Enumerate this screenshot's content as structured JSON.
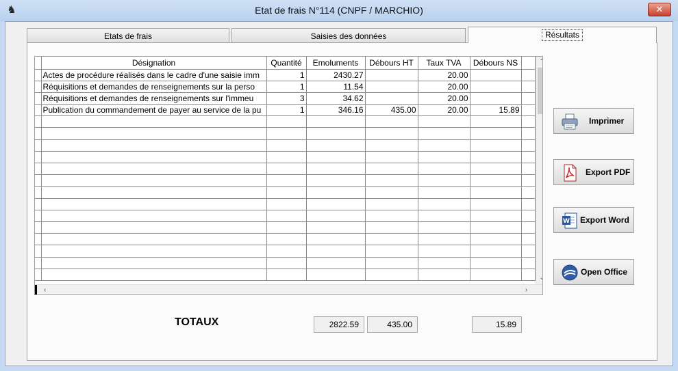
{
  "window": {
    "title": "Etat de frais N°114 (CNPF / MARCHIO)",
    "close_glyph": "✕"
  },
  "tabs": [
    {
      "label": "Etats de frais"
    },
    {
      "label": "Saisies des données"
    },
    {
      "label": "Résultats"
    }
  ],
  "grid": {
    "columns": [
      "Désignation",
      "Quantité",
      "Emoluments",
      "Débours HT",
      "Taux TVA",
      "Débours NS"
    ],
    "rows": [
      [
        "Actes de procédure réalisés dans le cadre d'une saisie imm",
        "1",
        "2430.27",
        "",
        "20.00",
        ""
      ],
      [
        "Réquisitions et demandes de renseignements sur la perso",
        "1",
        "11.54",
        "",
        "20.00",
        ""
      ],
      [
        "Réquisitions et demandes de renseignements sur l'immeu",
        "3",
        "34.62",
        "",
        "20.00",
        ""
      ],
      [
        "Publication du commandement de payer au service de la pu",
        "1",
        "346.16",
        "435.00",
        "20.00",
        "15.89"
      ]
    ],
    "empty_rows": 14
  },
  "buttons": {
    "imprimer": "Imprimer",
    "export_pdf": "Export PDF",
    "export_word": "Export Word",
    "open_office": "Open Office"
  },
  "totals": {
    "label": "TOTAUX",
    "emoluments": "2822.59",
    "debours_ht": "435.00",
    "debours_ns": "15.89"
  },
  "icons": [
    "app-icon",
    "printer-icon",
    "pdf-icon",
    "word-icon",
    "openoffice-icon",
    "scroll-up-icon",
    "scroll-down-icon",
    "scroll-left-icon",
    "scroll-right-icon"
  ]
}
